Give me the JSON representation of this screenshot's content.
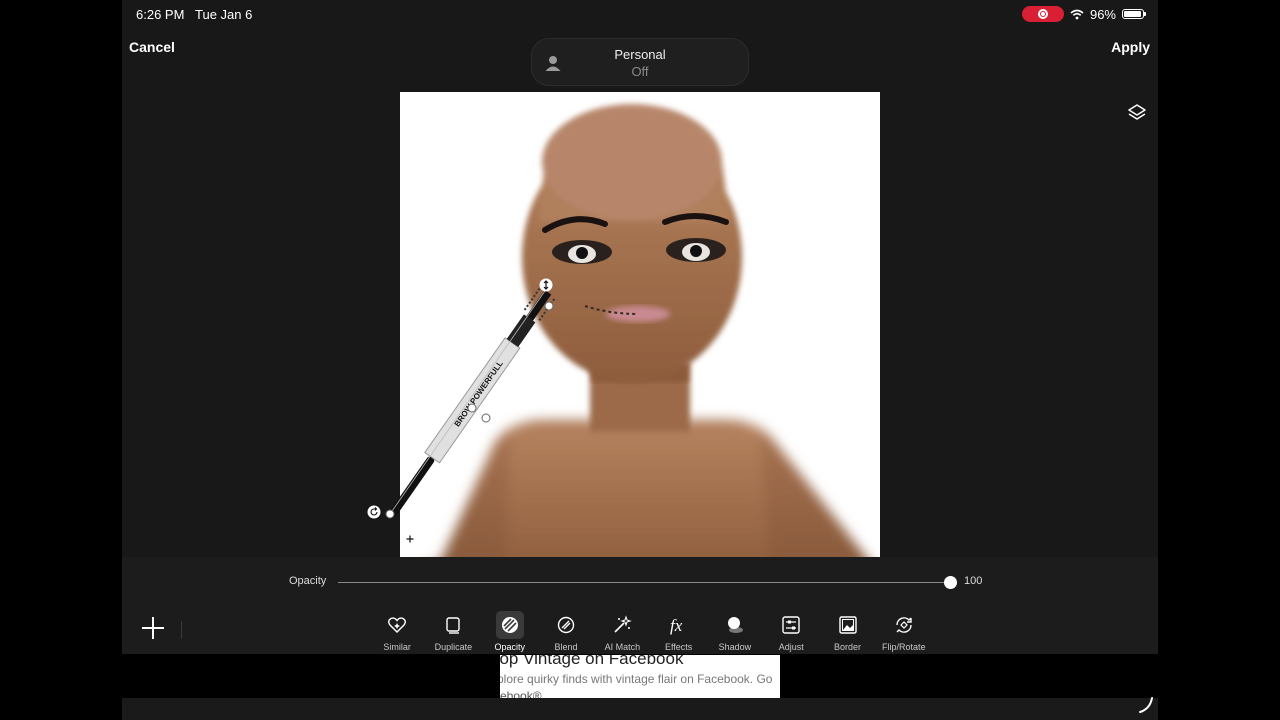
{
  "status_bar": {
    "time": "6:26 PM",
    "date": "Tue Jan 6",
    "battery": "96%",
    "battery_level": 0.96,
    "icons": [
      "screen-record-icon",
      "wifi-icon",
      "battery-icon"
    ]
  },
  "header": {
    "cancel_label": "Cancel",
    "apply_label": "Apply",
    "profile": {
      "name": "Personal",
      "state": "Off",
      "icon": "person-icon"
    }
  },
  "canvas": {
    "background": "#ffffff",
    "pencil_brand_text": "BROW POWERFULL"
  },
  "opacity": {
    "label": "Opacity",
    "value": "100",
    "fraction": 1.0
  },
  "toolbar": {
    "add_icon": "plus-icon",
    "items": [
      {
        "label": "Similar",
        "icon": "heart-sparkle-icon"
      },
      {
        "label": "Duplicate",
        "icon": "duplicate-icon"
      },
      {
        "label": "Opacity",
        "icon": "opacity-icon",
        "active": true
      },
      {
        "label": "Blend",
        "icon": "blend-icon"
      },
      {
        "label": "AI Match",
        "icon": "magic-wand-icon"
      },
      {
        "label": "Effects",
        "icon": "fx-icon"
      },
      {
        "label": "Shadow",
        "icon": "shadow-icon"
      },
      {
        "label": "Adjust",
        "icon": "sliders-icon"
      },
      {
        "label": "Border",
        "icon": "image-border-icon"
      },
      {
        "label": "Flip/Rotate",
        "icon": "flip-rotate-icon"
      }
    ]
  },
  "ad": {
    "headline": "hop Vintage on Facebook",
    "description": "plore quirky finds with vintage flair on Facebook. Go",
    "sponsor": "cebook®"
  },
  "colors": {
    "accent_record": "#d81f33",
    "background": "#181818",
    "toolbar": "#1c1c1c"
  }
}
